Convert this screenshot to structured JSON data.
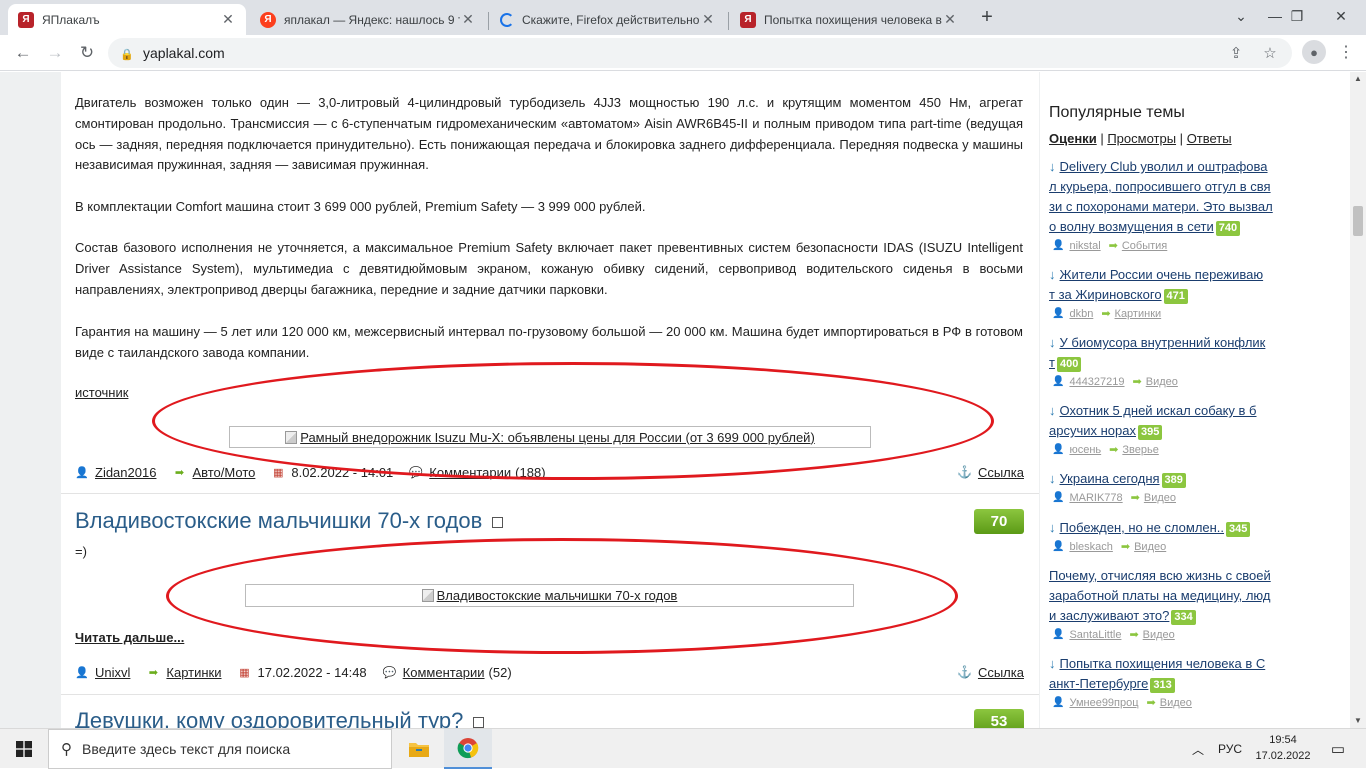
{
  "browser": {
    "tabs": [
      {
        "title": "ЯПлакалъ",
        "favicon": "yaplakal-favicon",
        "active": true
      },
      {
        "title": "яплакал — Яндекс: нашлось 9 т",
        "favicon": "yandex-favicon",
        "active": false
      },
      {
        "title": "Скажите, Firefox действительно",
        "favicon": "loading-spinner",
        "active": false
      },
      {
        "title": "Попытка похищения человека в",
        "favicon": "yaplakal-favicon",
        "active": false
      }
    ],
    "url": "yaplakal.com"
  },
  "article1": {
    "paragraphs": [
      "Двигатель возможен только один — 3,0-литровый 4-цилиндровый турбодизель 4JJ3 мощностью 190 л.с. и крутящим моментом 450 Нм, агрегат смонтирован продольно. Трансмиссия — с 6-ступенчатым гидромеханическим «автоматом» Aisin AWR6B45-II и полным приводом типа part-time (ведущая ось — задняя, передняя подключается принудительно). Есть понижающая передача и блокировка заднего дифференциала. Передняя подвеска у машины независимая пружинная, задняя — зависимая пружинная.",
      "В комплектации Comfort машина стоит 3 699 000 рублей, Premium Safety — 3 999 000 рублей.",
      "Состав базового исполнения не уточняется, а максимальное Premium Safety включает пакет превентивных систем безопасности IDAS (ISUZU Intelligent Driver Assistance System), мультимедиа с девятидюймовым экраном, кожаную обивку сидений, сервопривод водительского сиденья в восьми направлениях, электропривод дверцы багажника, передние и задние датчики парковки.",
      "Гарантия на машину — 5 лет или 120 000 км, межсервисный интервал по-грузовому большой — 20 000 км. Машина будет импортироваться в РФ в готовом виде с таиландского завода компании."
    ],
    "source_link": "источник",
    "image_alt": "Рамный внедорожник Isuzu Mu-X: объявлены цены для России (от 3 699 000 рублей)",
    "author": "Zidan2016",
    "category": "Авто/Мото",
    "date": "8.02.2022 - 14:01",
    "comments": "Комментарии",
    "comments_count": "(188)",
    "link_label": "Ссылка"
  },
  "article2": {
    "title": "Владивостокские мальчишки 70-х годов",
    "rating": "70",
    "intro": "=)",
    "image_alt": "Владивостокские мальчишки 70-х годов",
    "read_more": "Читать дальше...",
    "author": "Unixvl",
    "category": "Картинки",
    "date": "17.02.2022 - 14:48",
    "comments": "Комментарии",
    "comments_count": "(52)",
    "link_label": "Ссылка"
  },
  "article3": {
    "title": "Девушки, кому оздоровительный тур?",
    "rating": "53"
  },
  "sidebar": {
    "title": "Популярные темы",
    "filters": [
      "Оценки",
      "Просмотры",
      "Ответы"
    ],
    "separator": "|",
    "items": [
      {
        "lines": [
          "Delivery Club уволил и оштрафова",
          "л курьера, попросившего отгул в свя",
          "зи с похоронами матери. Это вызвал",
          "о волну возмущения в сети"
        ],
        "count": "740",
        "user": "nikstal",
        "section": "События"
      },
      {
        "lines": [
          "Жители России очень переживаю",
          "т за Жириновского"
        ],
        "count": "471",
        "user": "dkbn",
        "section": "Картинки"
      },
      {
        "lines": [
          "У биомусора внутренний конфлик",
          "т"
        ],
        "count": "400",
        "user": "444327219",
        "section": "Видео"
      },
      {
        "lines": [
          "Охотник 5 дней искал собаку в б",
          "арсучих норах"
        ],
        "count": "395",
        "user": "юсень",
        "section": "Зверье"
      },
      {
        "lines": [
          "Украина сегодня"
        ],
        "count": "389",
        "user": "MARIK778",
        "section": "Видео"
      },
      {
        "lines": [
          "Побежден, но не сломлен.."
        ],
        "count": "345",
        "user": "bleskach",
        "section": "Видео"
      },
      {
        "lines": [
          "Почему, отчисляя всю жизнь с своей",
          "заработной платы на медицину, люд",
          "и заслуживают это?"
        ],
        "count": "334",
        "user": "SantaLittle",
        "section": "Видео"
      },
      {
        "lines": [
          "Попытка похищения человека в С",
          "анкт-Петербурге"
        ],
        "count": "313",
        "user": "Умнее99проц",
        "section": "Видео"
      }
    ]
  },
  "taskbar": {
    "search_placeholder": "Введите здесь текст для поиска",
    "language": "РУС",
    "time": "19:54",
    "date": "17.02.2022"
  }
}
